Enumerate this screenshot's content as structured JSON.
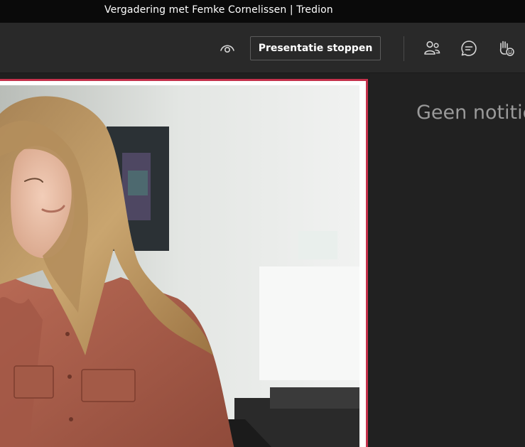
{
  "window": {
    "title": "Vergadering met Femke Cornelissen | Tredion"
  },
  "toolbar": {
    "view_icon": "eye-icon",
    "stop_presenting_label": "Presentatie stoppen",
    "participants_icon": "people-icon",
    "chat_icon": "chat-icon",
    "reactions_icon": "raise-hand-icon"
  },
  "stage": {
    "highlight_color": "#c4314b",
    "content_icon": "shared-photo"
  },
  "notes": {
    "empty_text": "Geen notitie"
  }
}
